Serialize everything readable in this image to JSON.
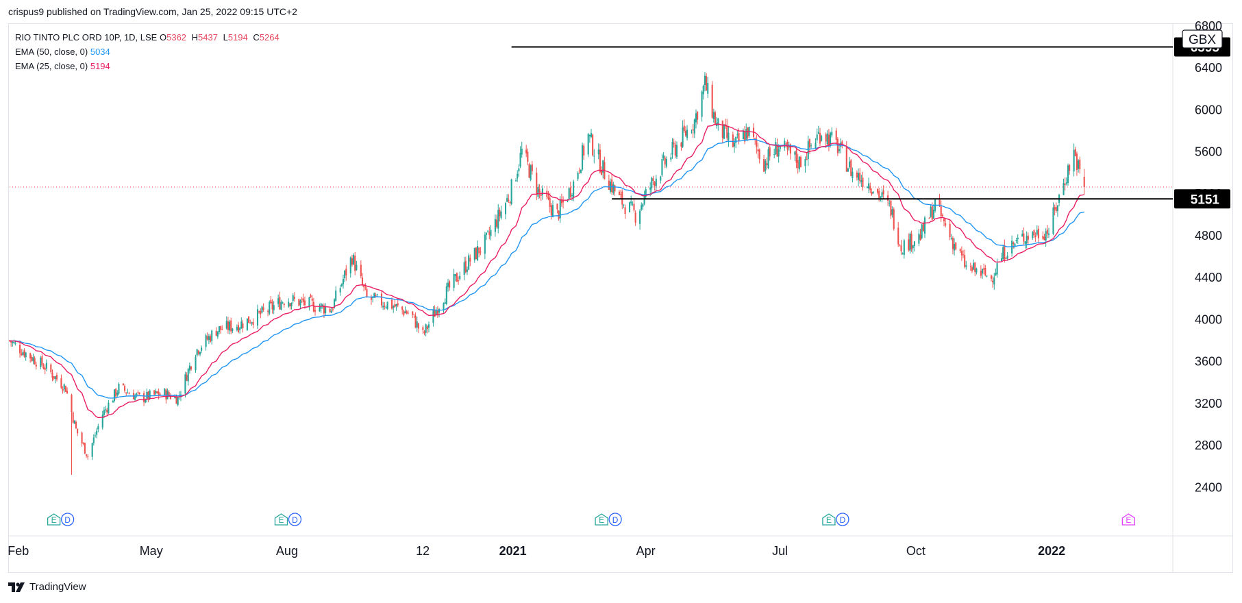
{
  "header": {
    "publisher_line": "crispus9 published on TradingView.com, Jan 25, 2022 09:15 UTC+2"
  },
  "legend": {
    "symbol": "RIO TINTO PLC ORD 10P, 1D, LSE",
    "ohlc": [
      {
        "key": "O",
        "value": "5362"
      },
      {
        "key": "H",
        "value": "5437"
      },
      {
        "key": "L",
        "value": "5194"
      },
      {
        "key": "C",
        "value": "5264"
      }
    ],
    "ema50_label": "EMA (50, close, 0)",
    "ema50_value": "5034",
    "ema25_label": "EMA (25, close, 0)",
    "ema25_value": "5194"
  },
  "footer": {
    "brand": "TradingView"
  },
  "colors": {
    "up": "#26a69a",
    "down": "#ef5350",
    "ema50": "#2196f3",
    "ema25": "#e91e63",
    "hline": "#000000",
    "last_price": "#f23645"
  },
  "chart_data": {
    "type": "candlestick",
    "currency": "GBX",
    "ylim": [
      2150,
      6850
    ],
    "y_ticks": [
      "2400",
      "2800",
      "3200",
      "3600",
      "4000",
      "4400",
      "4800",
      "5200",
      "5600",
      "6000",
      "6400",
      "6800"
    ],
    "x_ticks": [
      {
        "label": "Feb",
        "date": "2020-02-01",
        "bold": false
      },
      {
        "label": "May",
        "date": "2020-05-01",
        "bold": false
      },
      {
        "label": "Aug",
        "date": "2020-08-01",
        "bold": false
      },
      {
        "label": "12",
        "date": "2020-11-01",
        "bold": false
      },
      {
        "label": "2021",
        "date": "2021-01-01",
        "bold": true
      },
      {
        "label": "Apr",
        "date": "2021-04-01",
        "bold": false
      },
      {
        "label": "Jul",
        "date": "2021-07-01",
        "bold": false
      },
      {
        "label": "Oct",
        "date": "2021-10-01",
        "bold": false
      },
      {
        "label": "2022",
        "date": "2022-01-01",
        "bold": true
      }
    ],
    "x_range": [
      "2020-01-27",
      "2022-03-25"
    ],
    "close_anchors": [
      [
        "2020-01-27",
        3800
      ],
      [
        "2020-02-05",
        3700
      ],
      [
        "2020-02-20",
        3550
      ],
      [
        "2020-03-05",
        3350
      ],
      [
        "2020-03-12",
        2950
      ],
      [
        "2020-03-20",
        2700
      ],
      [
        "2020-03-30",
        3100
      ],
      [
        "2020-04-10",
        3350
      ],
      [
        "2020-04-25",
        3250
      ],
      [
        "2020-05-10",
        3300
      ],
      [
        "2020-05-20",
        3250
      ],
      [
        "2020-06-01",
        3700
      ],
      [
        "2020-06-15",
        3900
      ],
      [
        "2020-06-30",
        3950
      ],
      [
        "2020-07-15",
        4050
      ],
      [
        "2020-08-01",
        4200
      ],
      [
        "2020-08-15",
        4150
      ],
      [
        "2020-09-01",
        4100
      ],
      [
        "2020-09-15",
        4600
      ],
      [
        "2020-09-25",
        4200
      ],
      [
        "2020-10-10",
        4150
      ],
      [
        "2020-10-25",
        4050
      ],
      [
        "2020-11-02",
        3850
      ],
      [
        "2020-11-15",
        4200
      ],
      [
        "2020-11-30",
        4500
      ],
      [
        "2020-12-15",
        4750
      ],
      [
        "2020-12-31",
        5200
      ],
      [
        "2021-01-08",
        5600
      ],
      [
        "2021-01-20",
        5200
      ],
      [
        "2021-02-01",
        5000
      ],
      [
        "2021-02-12",
        5300
      ],
      [
        "2021-02-22",
        5750
      ],
      [
        "2021-03-05",
        5400
      ],
      [
        "2021-03-15",
        5150
      ],
      [
        "2021-03-26",
        5000
      ],
      [
        "2021-04-08",
        5350
      ],
      [
        "2021-04-20",
        5600
      ],
      [
        "2021-05-05",
        5900
      ],
      [
        "2021-05-12",
        6250
      ],
      [
        "2021-05-20",
        5850
      ],
      [
        "2021-06-01",
        5650
      ],
      [
        "2021-06-10",
        5800
      ],
      [
        "2021-06-21",
        5500
      ],
      [
        "2021-07-01",
        5650
      ],
      [
        "2021-07-15",
        5500
      ],
      [
        "2021-07-30",
        5800
      ],
      [
        "2021-08-10",
        5650
      ],
      [
        "2021-08-20",
        5400
      ],
      [
        "2021-09-01",
        5300
      ],
      [
        "2021-09-15",
        5050
      ],
      [
        "2021-09-22",
        4700
      ],
      [
        "2021-10-05",
        4800
      ],
      [
        "2021-10-15",
        5100
      ],
      [
        "2021-10-25",
        4800
      ],
      [
        "2021-11-05",
        4500
      ],
      [
        "2021-11-22",
        4400
      ],
      [
        "2021-12-01",
        4650
      ],
      [
        "2021-12-15",
        4800
      ],
      [
        "2021-12-31",
        4850
      ],
      [
        "2022-01-10",
        5300
      ],
      [
        "2022-01-17",
        5600
      ],
      [
        "2022-01-21",
        5400
      ],
      [
        "2022-01-24",
        5264
      ]
    ],
    "last_candle": {
      "open": 5362,
      "high": 5437,
      "low": 5194,
      "close": 5264
    },
    "ema50_last": 5034,
    "ema25_last": 5194,
    "last_price": 5264,
    "horizontal_lines": [
      {
        "value": 6600,
        "label": "6595",
        "from_date": "2021-01-01"
      },
      {
        "value": 5151,
        "label": "5151",
        "from_date": "2021-03-10"
      }
    ],
    "events": [
      {
        "date": "2020-02-26",
        "labels": [
          "E",
          "D"
        ]
      },
      {
        "date": "2020-07-29",
        "labels": [
          "E",
          "D"
        ]
      },
      {
        "date": "2021-03-03",
        "labels": [
          "E",
          "D"
        ]
      },
      {
        "date": "2021-08-04",
        "labels": [
          "E",
          "D"
        ]
      },
      {
        "date": "2022-02-23",
        "labels": [
          "E"
        ]
      }
    ]
  }
}
